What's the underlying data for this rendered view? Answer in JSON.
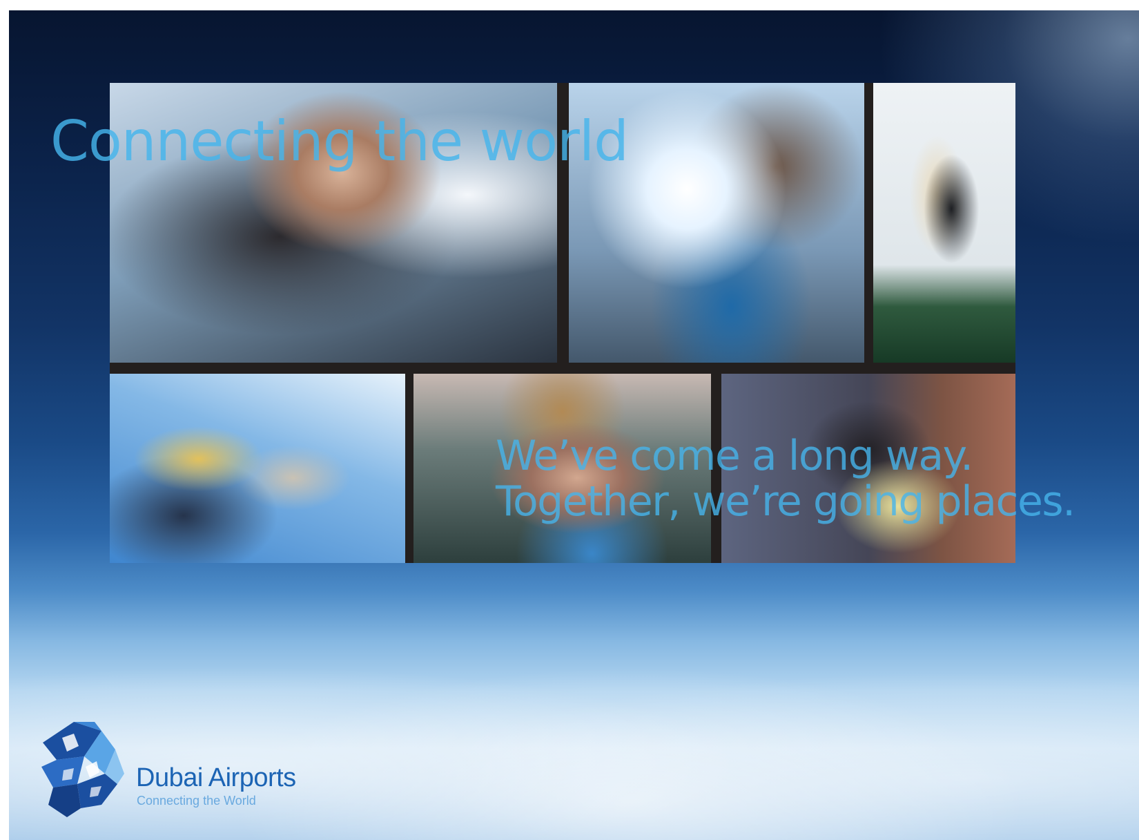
{
  "slide": {
    "headline": "Connecting the world",
    "tagline_line1": "We’ve come a long way.",
    "tagline_line2": "Together, we’re going places."
  },
  "brand": {
    "name": "Dubai Airports",
    "tagline": "Connecting the World",
    "logo_icon": "dubai-airports-logo-icon"
  },
  "photos": [
    {
      "subject": "woman-with-windswept-hair"
    },
    {
      "subject": "man-in-sunlight"
    },
    {
      "subject": "mother-and-child-at-window"
    },
    {
      "subject": "man-swinging-child"
    },
    {
      "subject": "boy-portrait"
    },
    {
      "subject": "woman-at-night-terrace"
    }
  ],
  "colors": {
    "text_accent": "#46b4eb",
    "brand_blue": "#1c64b4",
    "brand_light_blue": "#69a9df"
  }
}
